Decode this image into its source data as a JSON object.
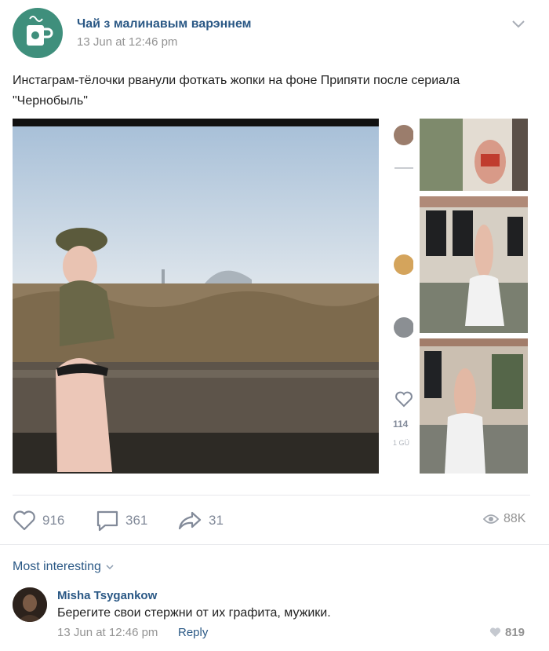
{
  "post": {
    "group_name": "Чай з малинавым варэннем",
    "time": "13 Jun at 12:46 pm",
    "text": "Инстаграм-тёлочки рванули фоткать жопки на фоне Припяти после сериала \"Чернобыль\""
  },
  "strip": {
    "likes": "114",
    "caption": "1 GÜ"
  },
  "actions": {
    "likes": "916",
    "comments": "361",
    "shares": "31",
    "views": "88K"
  },
  "comments": {
    "sort_label": "Most interesting",
    "items": [
      {
        "author": "Misha Tsygankow",
        "text": "Берегите свои стержни от их графита, мужики.",
        "time": "13 Jun at 12:46 pm",
        "reply_label": "Reply",
        "likes": "819"
      }
    ]
  },
  "colors": {
    "link": "#2a5885",
    "muted": "#939393",
    "action": "#828a99",
    "avatar_bg": "#3f8f7c"
  },
  "icons": [
    "mug-icon",
    "chevron-down-icon",
    "heart-icon",
    "comment-icon",
    "share-icon",
    "eye-icon"
  ]
}
